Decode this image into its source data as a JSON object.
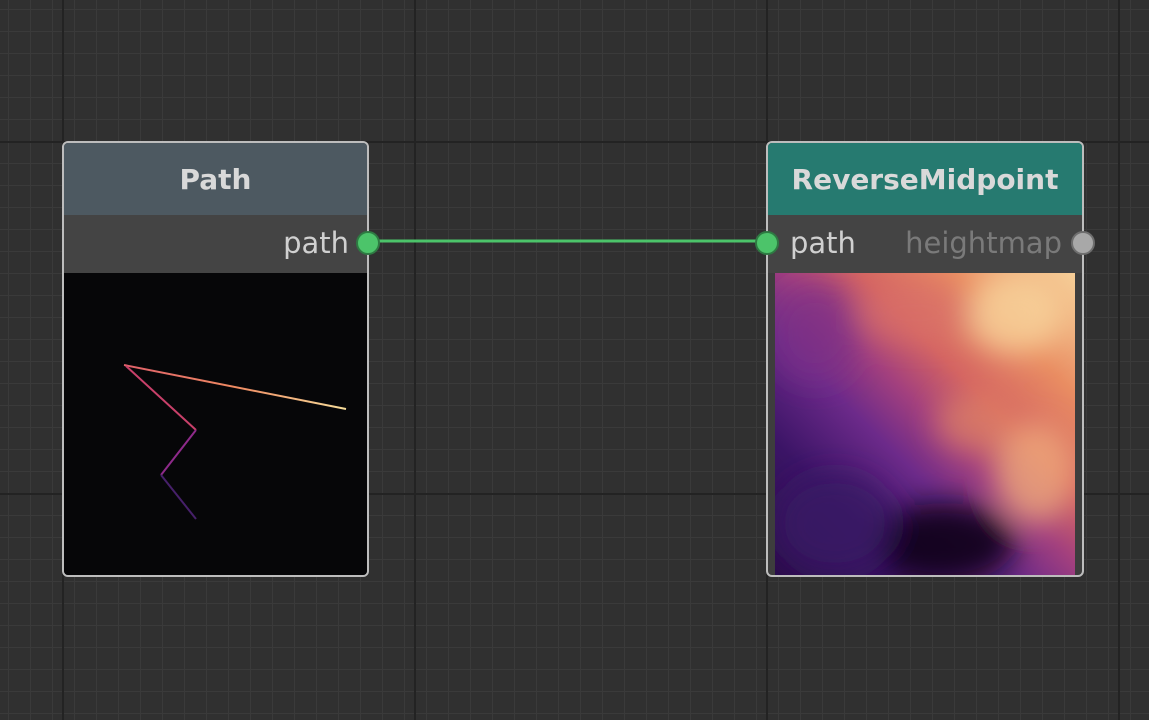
{
  "nodes": {
    "path": {
      "title": "Path",
      "output_port": "path",
      "header_color": "#4d5961"
    },
    "reverse_midpoint": {
      "title": "ReverseMidpoint",
      "input_port": "path",
      "output_port": "heightmap",
      "header_color": "#267a70"
    }
  },
  "colors": {
    "connected_port": "#4cc46a",
    "unconnected_port": "#a8a8a8",
    "connection_wire": "#4cc46a",
    "active_label": "#d0d0d0",
    "inactive_label": "#7a7a7a"
  }
}
